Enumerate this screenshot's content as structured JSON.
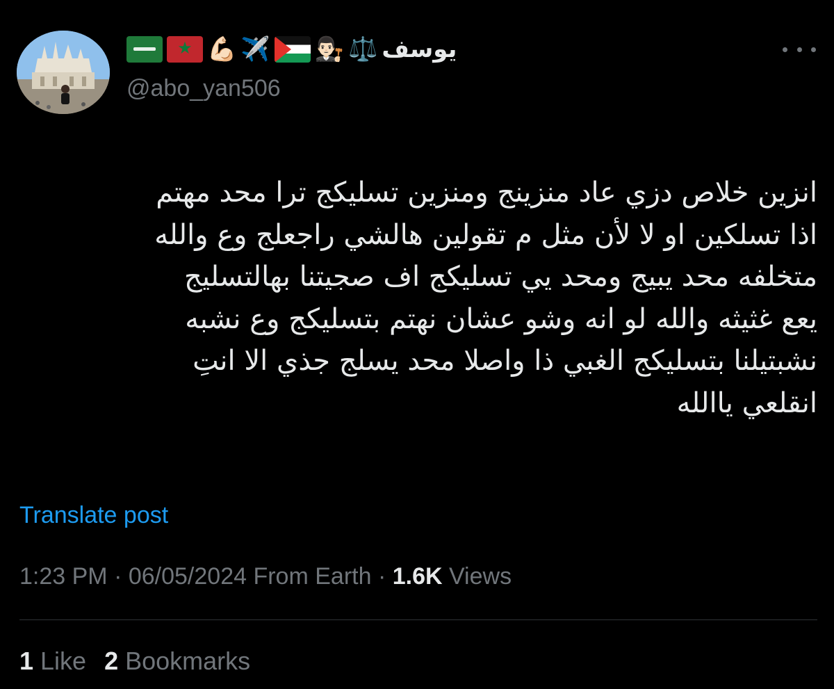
{
  "user": {
    "display_name": "يوسف",
    "handle": "@abo_yan506",
    "name_emojis": [
      "⚖️",
      "👨🏻‍⚖️",
      "🇵🇸",
      "✈️",
      "💪🏻",
      "🇲🇦",
      "🇸🇦"
    ]
  },
  "post": {
    "lines": [
      "انزين خلاص دزي عاد منزينج ومنزين تسليكج ترا محد مهتم",
      "اذا تسلكين او لا لأن مثل م تقولين هالشي راجعلج وع والله",
      "متخلفه محد يبيج ومحد يي تسليكج اف صجيتنا بهالتسليج",
      "يعع غثيثه والله لو انه وشو عشان نهتم بتسليكج وع نشبه",
      "نشبتيلنا بتسليكج الغبي ذا واصلا محد يسلج جذي الا انتِ",
      "انقلعي ياالله"
    ],
    "translate_label": "Translate post"
  },
  "meta": {
    "time": "1:23 PM",
    "sep1": " · ",
    "date": "06/05/2024",
    "source": " From Earth",
    "sep2": " · ",
    "views_count": "1.6K",
    "views_label": " Views"
  },
  "stats": {
    "likes_count": "1",
    "likes_label": " Like",
    "bookmarks_count": "2",
    "bookmarks_label": " Bookmarks"
  },
  "colors": {
    "background": "#000000",
    "text": "#e7e9ea",
    "muted": "#71767b",
    "link": "#1d9bf0",
    "divider": "#2f3336"
  }
}
